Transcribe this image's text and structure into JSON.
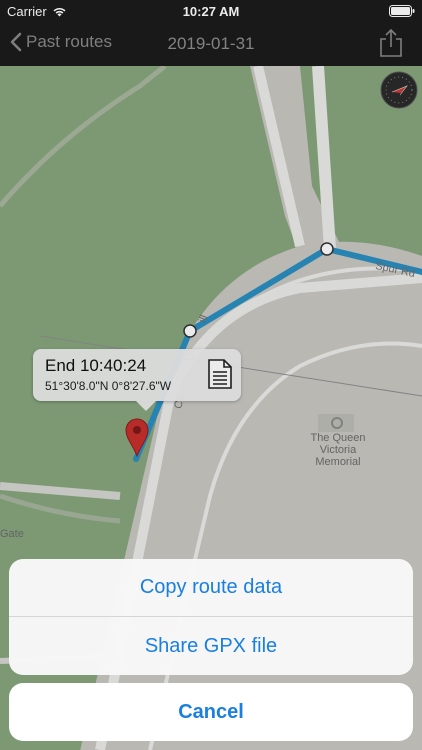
{
  "status_bar": {
    "carrier": "Carrier",
    "time": "10:27 AM",
    "wifi_icon": "wifi-icon",
    "battery_icon": "battery-icon"
  },
  "nav": {
    "back_label": "Past routes",
    "title": "2019-01-31",
    "share_icon": "share-icon"
  },
  "map": {
    "road_label_1": "Spur Rd",
    "road_label_2": "Co",
    "road_label_3": "ill",
    "poi_name_line1": "The Queen",
    "poi_name_line2": "Victoria",
    "poi_name_line3": "Memorial",
    "edge_label": "Gate",
    "compass_icon": "compass-icon",
    "route_color": "#2a8fc2",
    "pin_color": "#c7302c"
  },
  "callout": {
    "title": "End 10:40:24",
    "coordinates": "51°30'8.0\"N 0°8'27.6\"W",
    "doc_icon": "document-icon"
  },
  "action_sheet": {
    "copy_label": "Copy route data",
    "share_label": "Share GPX file",
    "cancel_label": "Cancel",
    "accent_color": "#1a7fe0"
  }
}
